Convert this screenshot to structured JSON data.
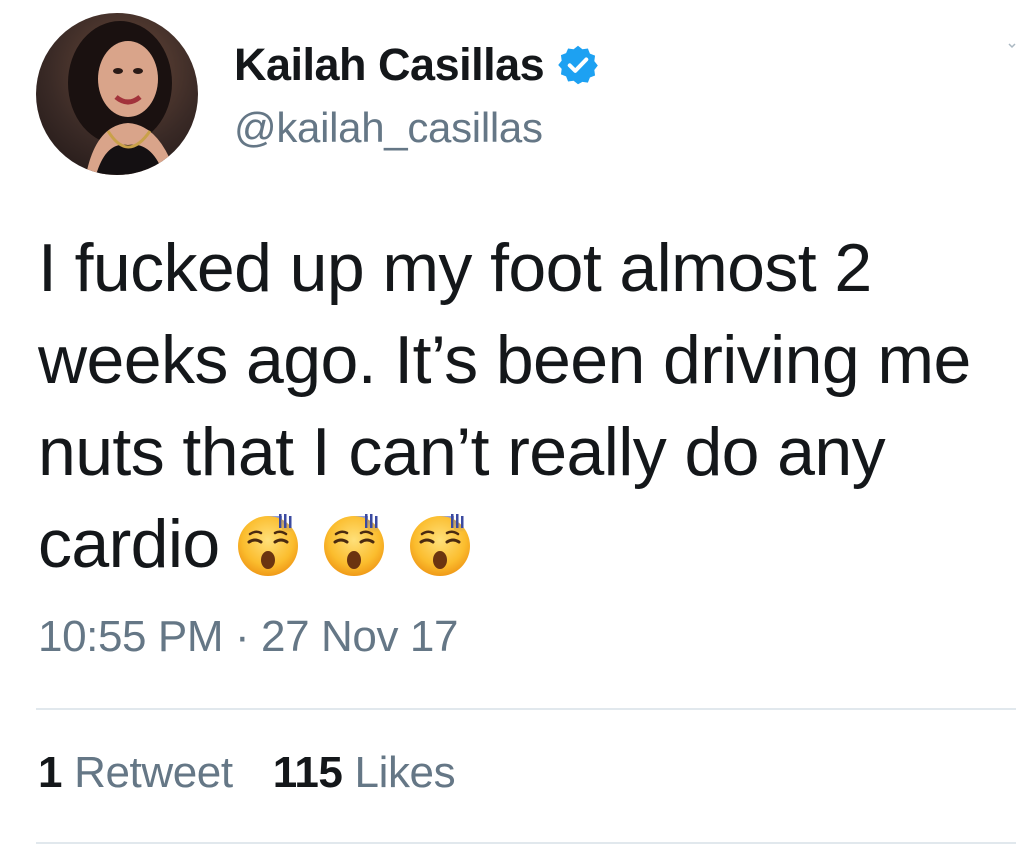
{
  "author": {
    "display_name": "Kailah Casillas",
    "handle": "@kailah_casillas",
    "verified": true
  },
  "tweet": {
    "text": "I fucked up my foot almost 2 weeks ago. It’s been driving me nuts that I can’t really do any cardio",
    "emojis": [
      "hushed-sweat-face-emoji",
      "hushed-sweat-face-emoji",
      "hushed-sweat-face-emoji"
    ],
    "timestamp": "10:55 PM · 27 Nov 17"
  },
  "stats": {
    "retweets_count": "1",
    "retweets_label": "Retweet",
    "likes_count": "115",
    "likes_label": "Likes"
  },
  "colors": {
    "verified_badge": "#1da1f2",
    "secondary_text": "#657786",
    "primary_text": "#14171a",
    "divider": "#e1e8ed"
  }
}
